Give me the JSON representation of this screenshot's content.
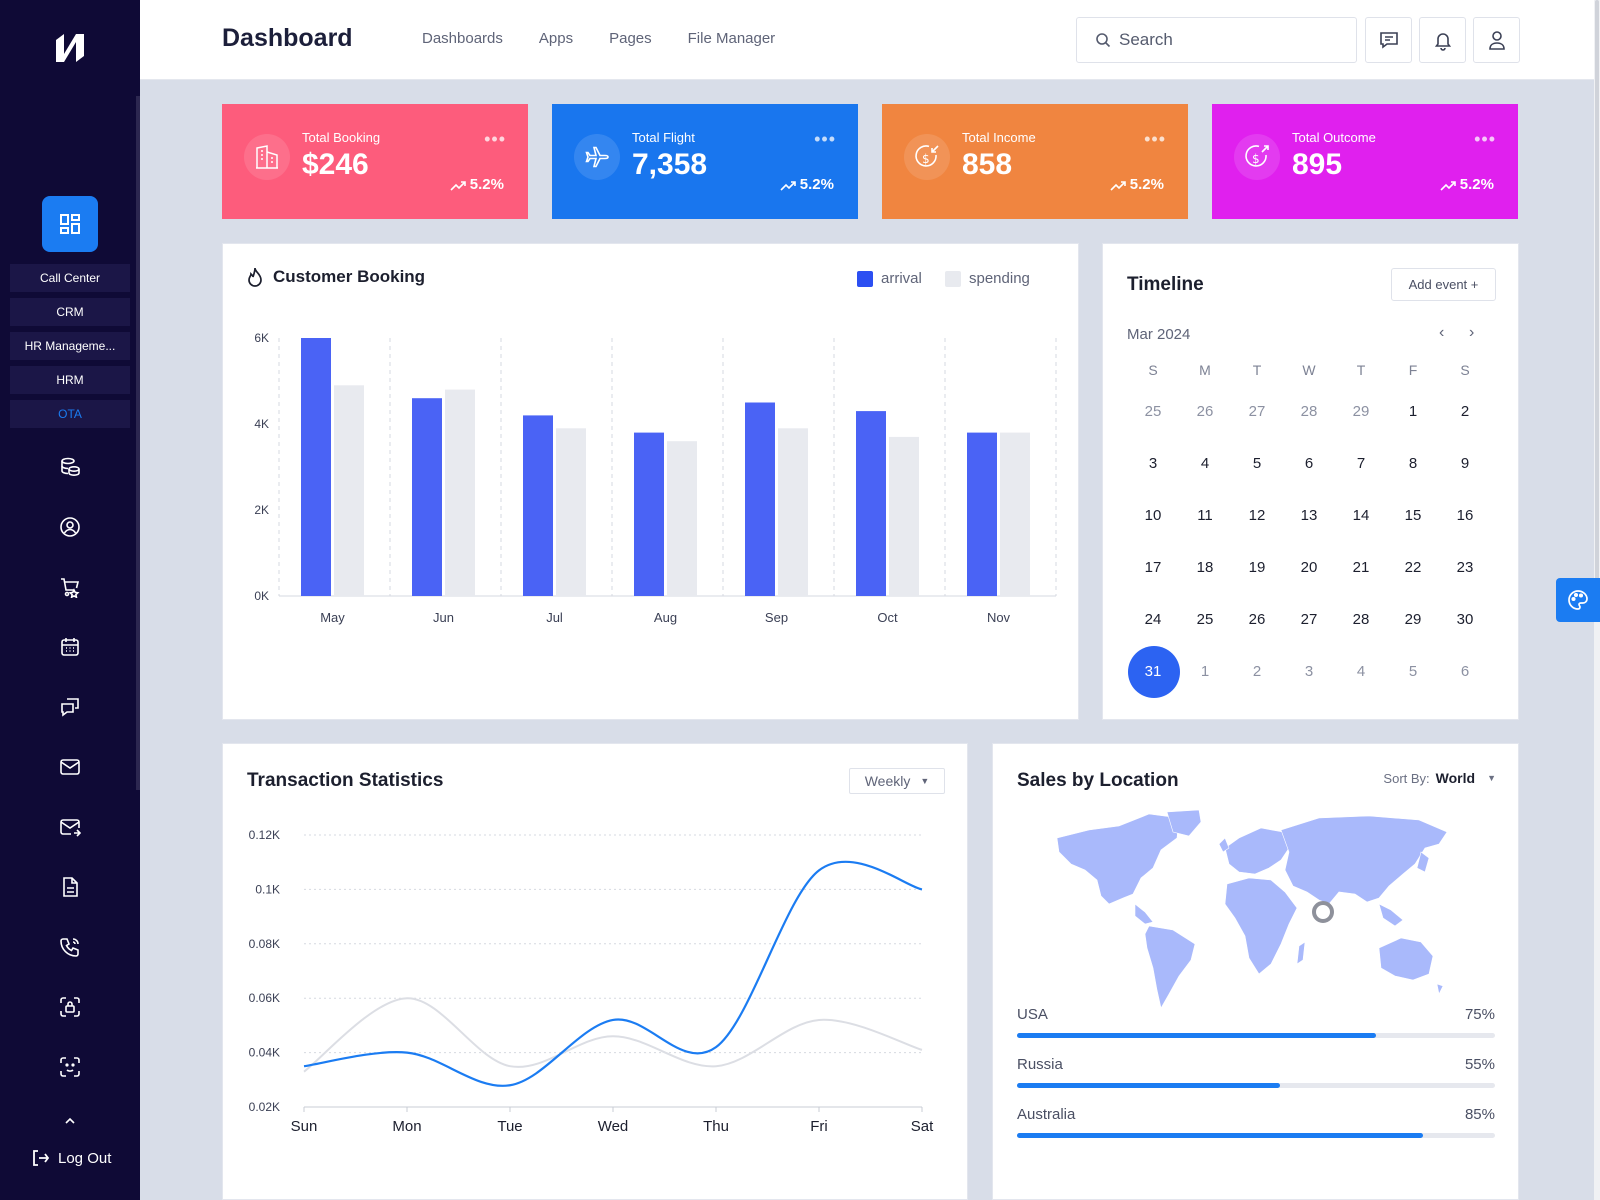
{
  "header": {
    "title": "Dashboard",
    "nav": [
      "Dashboards",
      "Apps",
      "Pages",
      "File Manager"
    ],
    "search_placeholder": "Search"
  },
  "sidebar": {
    "submenu": [
      "Call Center",
      "CRM",
      "HR Manageme...",
      "HRM",
      "OTA"
    ],
    "active_submenu": "OTA",
    "icons": [
      "dashboard-icon",
      "database-icon",
      "user-circle-icon",
      "cart-icon",
      "calendar-icon",
      "chat-icon",
      "mail-icon",
      "mail-forward-icon",
      "document-icon",
      "phone-icon",
      "face-lock-icon",
      "scan-icon"
    ],
    "logout_label": "Log Out"
  },
  "stats": [
    {
      "label": "Total Booking",
      "value": "$246",
      "change": "5.2%",
      "color": "#fd5c7c",
      "icon": "building-icon"
    },
    {
      "label": "Total Flight",
      "value": "7,358",
      "change": "5.2%",
      "color": "#1976ee",
      "icon": "plane-icon"
    },
    {
      "label": "Total Income",
      "value": "858",
      "change": "5.2%",
      "color": "#f08540",
      "icon": "income-icon"
    },
    {
      "label": "Total Outcome",
      "value": "895",
      "change": "5.2%",
      "color": "#e020ee",
      "icon": "outcome-icon"
    }
  ],
  "booking": {
    "title": "Customer Booking",
    "legend": [
      "arrival",
      "spending"
    ]
  },
  "timeline": {
    "title": "Timeline",
    "add_button": "Add event +",
    "month": "Mar 2024",
    "weekdays": [
      "S",
      "M",
      "T",
      "W",
      "T",
      "F",
      "S"
    ],
    "weeks": [
      [
        "25",
        "26",
        "27",
        "28",
        "29",
        "1",
        "2"
      ],
      [
        "3",
        "4",
        "5",
        "6",
        "7",
        "8",
        "9"
      ],
      [
        "10",
        "11",
        "12",
        "13",
        "14",
        "15",
        "16"
      ],
      [
        "17",
        "18",
        "19",
        "20",
        "21",
        "22",
        "23"
      ],
      [
        "24",
        "25",
        "26",
        "27",
        "28",
        "29",
        "30"
      ],
      [
        "31",
        "1",
        "2",
        "3",
        "4",
        "5",
        "6"
      ]
    ],
    "selected_day": "31"
  },
  "transactions": {
    "title": "Transaction Statistics",
    "period": "Weekly"
  },
  "sales": {
    "title": "Sales by Location",
    "sort_label": "Sort By:",
    "sort_value": "World",
    "locations": [
      {
        "name": "USA",
        "percent": "75%",
        "value": 0.75
      },
      {
        "name": "Russia",
        "percent": "55%",
        "value": 0.55
      },
      {
        "name": "Australia",
        "percent": "85%",
        "value": 0.85
      }
    ]
  },
  "chart_data": [
    {
      "type": "bar",
      "categories": [
        "May",
        "Jun",
        "Jul",
        "Aug",
        "Sep",
        "Oct",
        "Nov"
      ],
      "series": [
        {
          "name": "arrival",
          "values": [
            6000,
            4600,
            4200,
            3800,
            4500,
            4300,
            3800
          ],
          "color": "#4a63f5"
        },
        {
          "name": "spending",
          "values": [
            4900,
            4800,
            3900,
            3600,
            3900,
            3700,
            3800
          ],
          "color": "#e8eaef"
        }
      ],
      "y_ticks": [
        "0K",
        "2K",
        "4K",
        "6K"
      ],
      "ylim": [
        0,
        6000
      ],
      "grid": "vertical-dashed"
    },
    {
      "type": "line",
      "categories": [
        "Sun",
        "Mon",
        "Tue",
        "Wed",
        "Thu",
        "Fri",
        "Sat"
      ],
      "series": [
        {
          "name": "",
          "values": [
            0.035,
            0.04,
            0.028,
            0.052,
            0.042,
            0.107,
            0.1
          ],
          "color": "#1b7cf2"
        },
        {
          "name": "",
          "values": [
            0.033,
            0.06,
            0.035,
            0.046,
            0.035,
            0.052,
            0.041
          ],
          "color": "#dcdee4"
        }
      ],
      "y_ticks": [
        "0.02K",
        "0.04K",
        "0.06K",
        "0.08K",
        "0.1K",
        "0.12K"
      ],
      "ylim": [
        0.02,
        0.12
      ],
      "grid": "horizontal-dotted"
    }
  ]
}
